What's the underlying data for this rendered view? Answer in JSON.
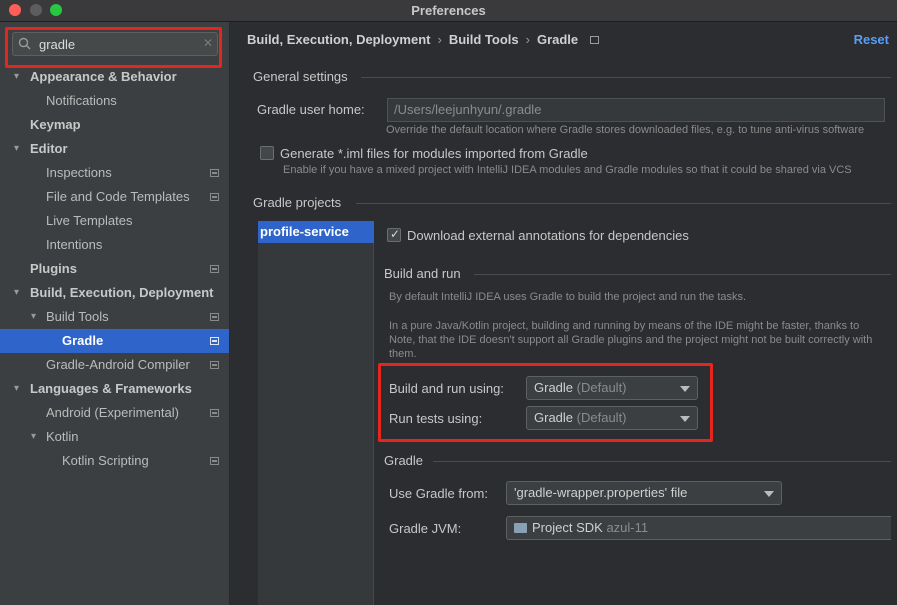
{
  "window": {
    "title": "Preferences"
  },
  "search": {
    "value": "gradle"
  },
  "tree": [
    {
      "label": "Appearance & Behavior",
      "level": 0,
      "arrow": "down",
      "bold": true,
      "project": false,
      "selected": false
    },
    {
      "label": "Notifications",
      "level": 1,
      "arrow": "",
      "bold": false,
      "project": false,
      "selected": false
    },
    {
      "label": "Keymap",
      "level": 0,
      "arrow": "",
      "bold": true,
      "project": false,
      "selected": false
    },
    {
      "label": "Editor",
      "level": 0,
      "arrow": "down",
      "bold": true,
      "project": false,
      "selected": false
    },
    {
      "label": "Inspections",
      "level": 1,
      "arrow": "",
      "bold": false,
      "project": true,
      "selected": false
    },
    {
      "label": "File and Code Templates",
      "level": 1,
      "arrow": "",
      "bold": false,
      "project": true,
      "selected": false
    },
    {
      "label": "Live Templates",
      "level": 1,
      "arrow": "",
      "bold": false,
      "project": false,
      "selected": false
    },
    {
      "label": "Intentions",
      "level": 1,
      "arrow": "",
      "bold": false,
      "project": false,
      "selected": false
    },
    {
      "label": "Plugins",
      "level": 0,
      "arrow": "",
      "bold": true,
      "project": true,
      "selected": false
    },
    {
      "label": "Build, Execution, Deployment",
      "level": 0,
      "arrow": "down",
      "bold": true,
      "project": false,
      "selected": false
    },
    {
      "label": "Build Tools",
      "level": 1,
      "arrow": "down",
      "bold": false,
      "project": true,
      "selected": false
    },
    {
      "label": "Gradle",
      "level": 2,
      "arrow": "",
      "bold": false,
      "project": true,
      "selected": true
    },
    {
      "label": "Gradle-Android Compiler",
      "level": 1,
      "arrow": "",
      "bold": false,
      "project": true,
      "selected": false
    },
    {
      "label": "Languages & Frameworks",
      "level": 0,
      "arrow": "down",
      "bold": true,
      "project": false,
      "selected": false
    },
    {
      "label": "Android (Experimental)",
      "level": 1,
      "arrow": "",
      "bold": false,
      "project": true,
      "selected": false
    },
    {
      "label": "Kotlin",
      "level": 1,
      "arrow": "down",
      "bold": false,
      "project": false,
      "selected": false
    },
    {
      "label": "Kotlin Scripting",
      "level": 2,
      "arrow": "",
      "bold": false,
      "project": true,
      "selected": false
    }
  ],
  "breadcrumb": {
    "items": [
      "Build, Execution, Deployment",
      "Build Tools",
      "Gradle"
    ],
    "reset": "Reset"
  },
  "general": {
    "title": "General settings",
    "user_home_label": "Gradle user home:",
    "user_home_value": "/Users/leejunhyun/.gradle",
    "user_home_hint": "Override the default location where Gradle stores downloaded files, e.g. to tune anti-virus software",
    "iml_label": "Generate *.iml files for modules imported from Gradle",
    "iml_hint": "Enable if you have a mixed project with IntelliJ IDEA modules and Gradle modules so that it could be shared via VCS",
    "iml_checked": false
  },
  "projects": {
    "title": "Gradle projects",
    "items": [
      "profile-service"
    ],
    "download_label": "Download external annotations for dependencies",
    "download_checked": true
  },
  "build_run": {
    "title": "Build and run",
    "desc1": "By default IntelliJ IDEA uses Gradle to build the project and run the tasks.",
    "desc2": "In a pure Java/Kotlin project, building and running by means of the IDE might be faster, thanks to",
    "desc3": "Note, that the IDE doesn't support all Gradle plugins and the project might not be built correctly with",
    "desc4": "them.",
    "build_label": "Build and run using:",
    "build_value": "Gradle",
    "build_suffix": "(Default)",
    "tests_label": "Run tests using:",
    "tests_value": "Gradle",
    "tests_suffix": "(Default)"
  },
  "gradle": {
    "title": "Gradle",
    "use_from_label": "Use Gradle from:",
    "use_from_value": "'gradle-wrapper.properties' file",
    "jvm_label": "Gradle JVM:",
    "jvm_value": "Project SDK",
    "jvm_suffix": "azul-11"
  },
  "colors": {
    "highlight": "#e5261f",
    "selection": "#2f65ca",
    "link": "#589df6"
  }
}
